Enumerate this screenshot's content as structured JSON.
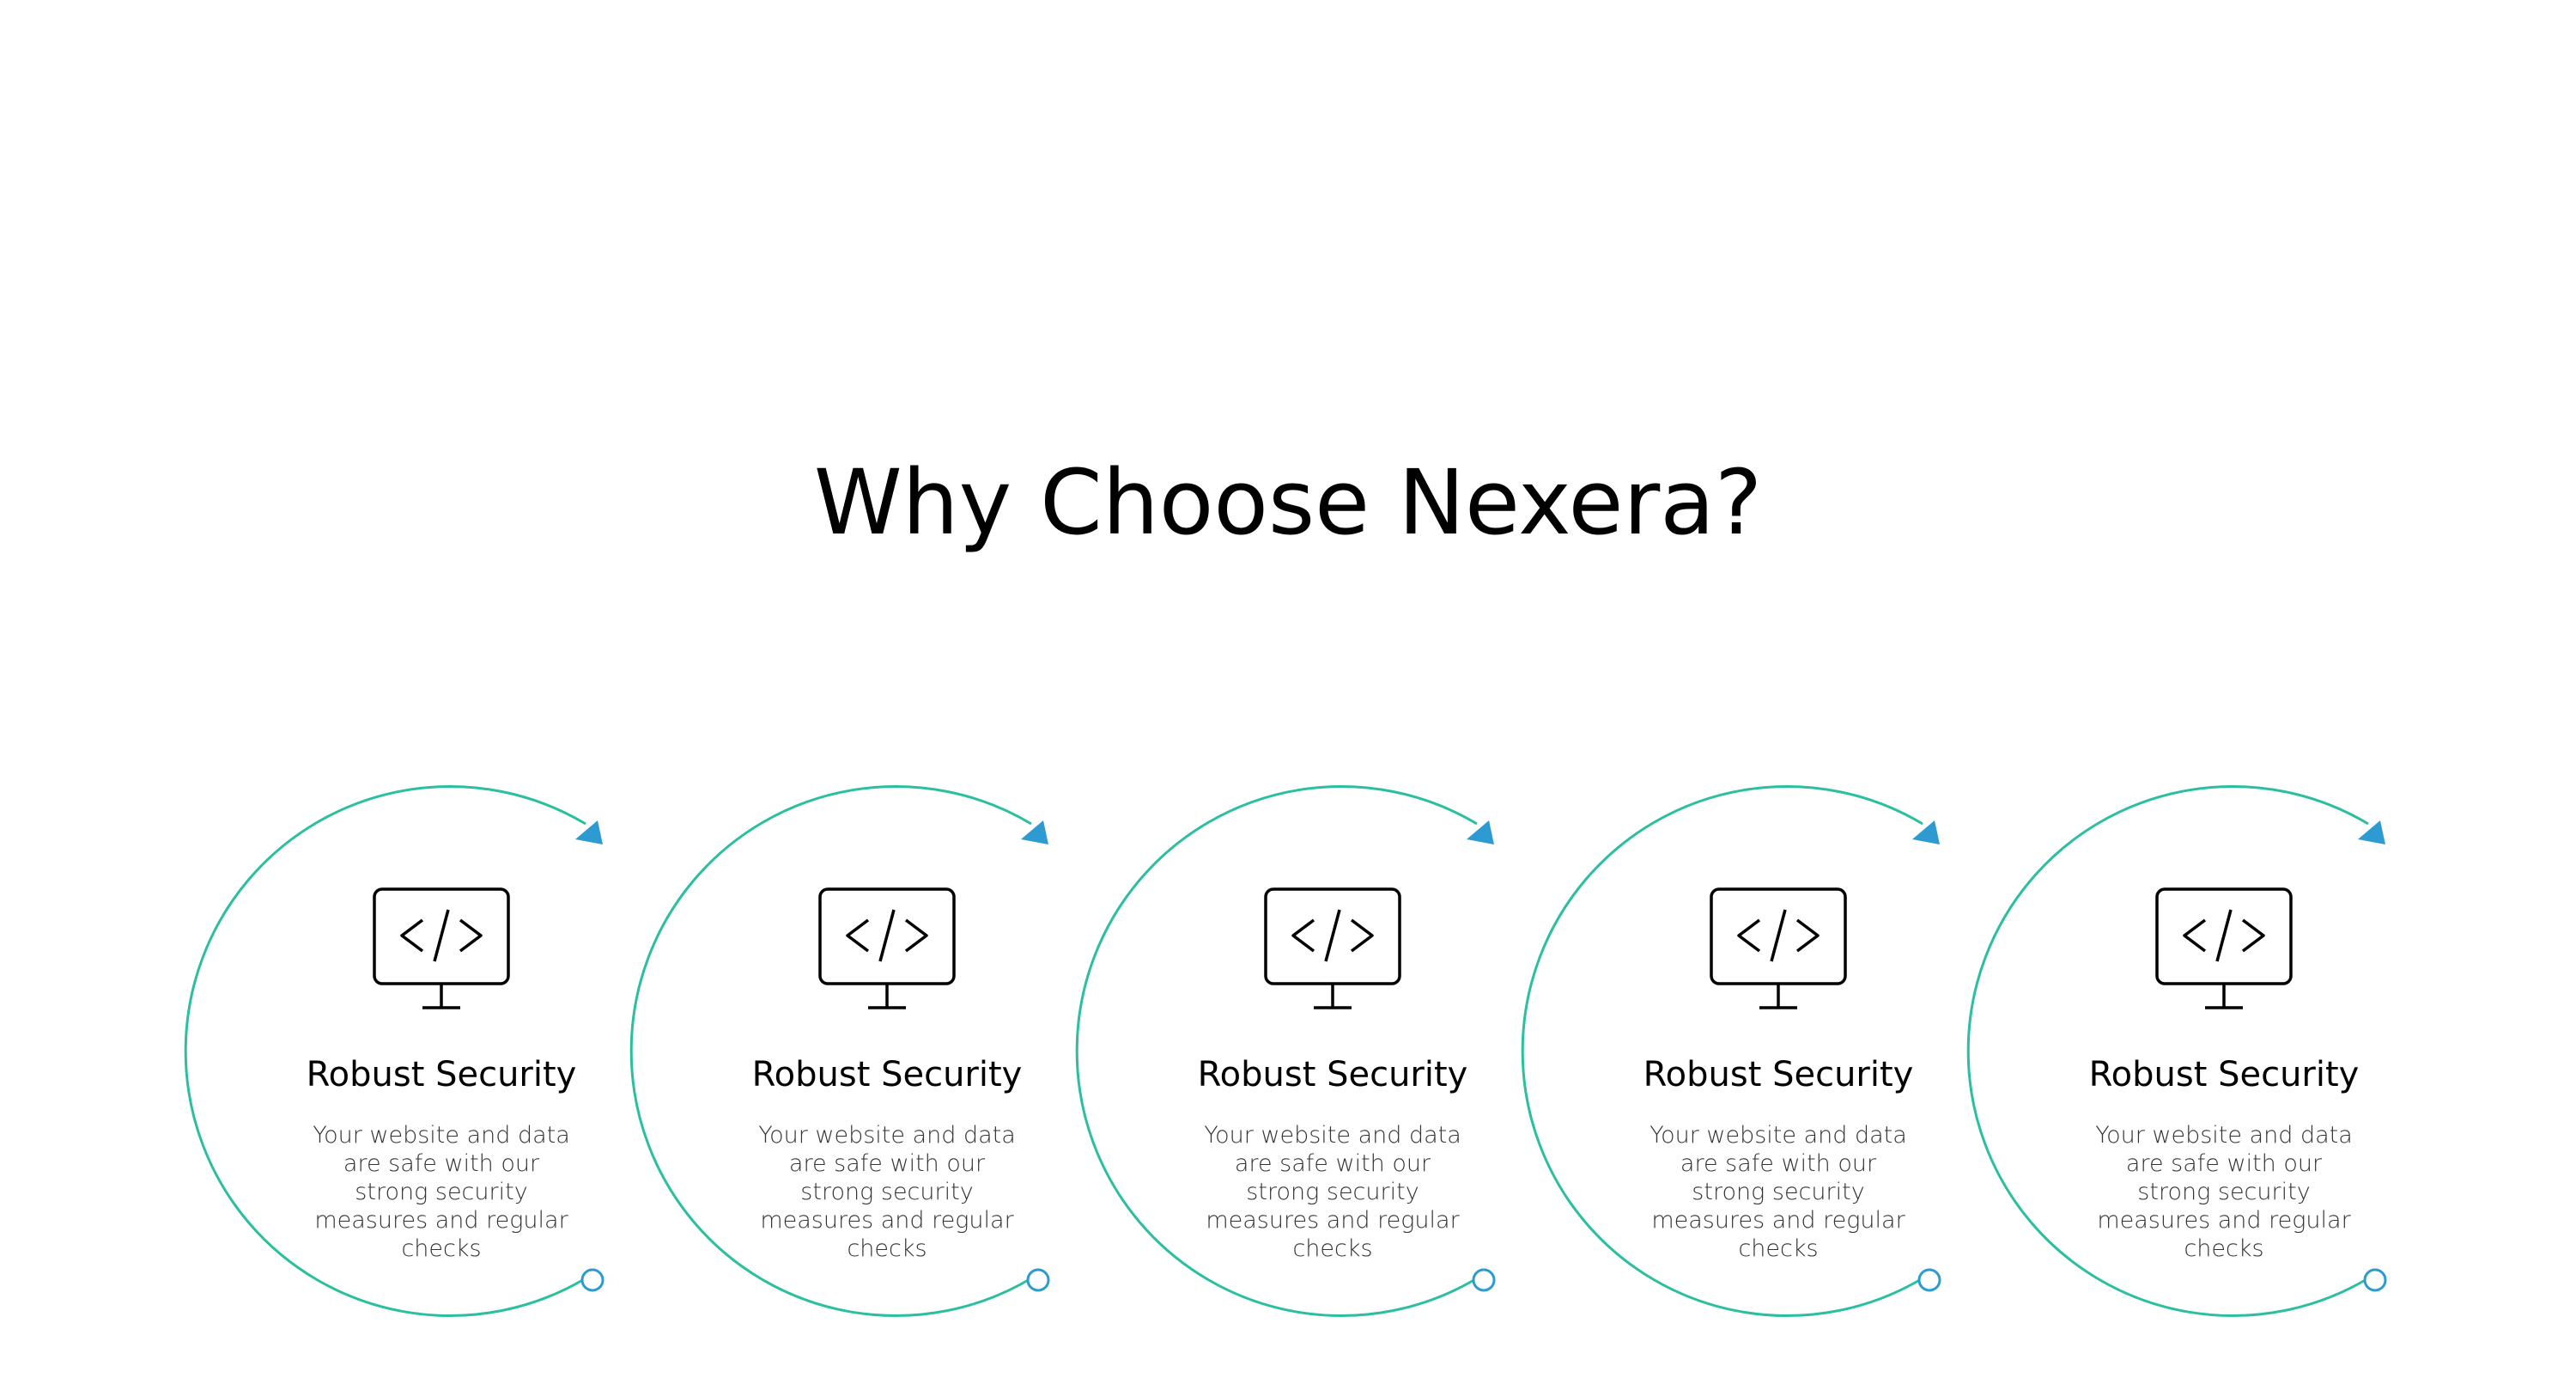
{
  "heading": "Why Choose Nexera?",
  "colors": {
    "ring": "#2bbf9f",
    "accent": "#2d9bd2",
    "text": "#000000",
    "muted": "#333333"
  },
  "features": [
    {
      "icon": "code-monitor-icon",
      "title": "Robust Security",
      "description": "Your website and data are safe with our strong security measures and regular checks"
    },
    {
      "icon": "code-monitor-icon",
      "title": "Robust Security",
      "description": "Your website and data are safe with our strong security measures and regular checks"
    },
    {
      "icon": "code-monitor-icon",
      "title": "Robust Security",
      "description": "Your website and data are safe with our strong security measures and regular checks"
    },
    {
      "icon": "code-monitor-icon",
      "title": "Robust Security",
      "description": "Your website and data are safe with our strong security measures and regular checks"
    },
    {
      "icon": "code-monitor-icon",
      "title": "Robust Security",
      "description": "Your website and data are safe with our strong security measures and regular checks"
    }
  ]
}
